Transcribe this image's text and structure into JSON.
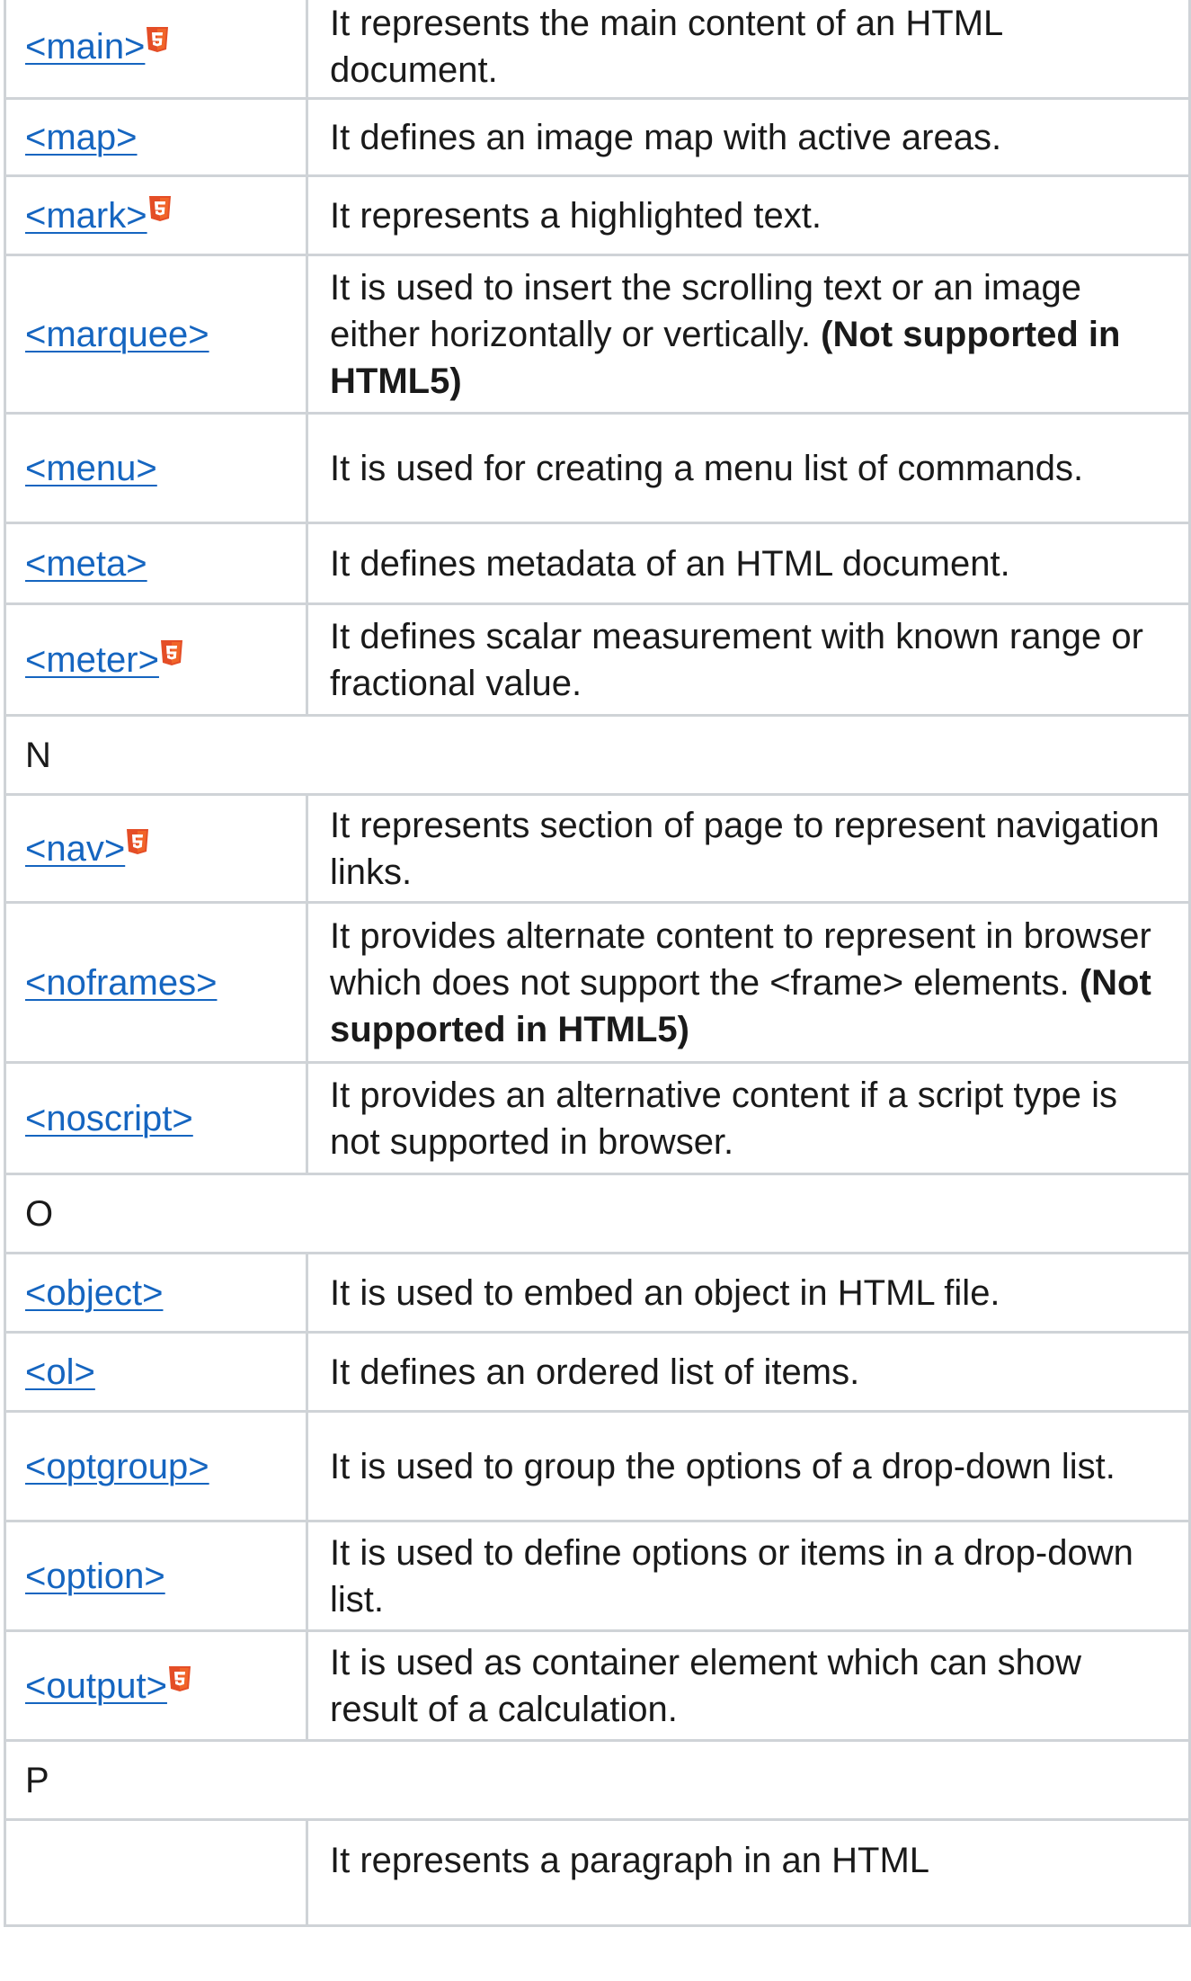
{
  "colors": {
    "link": "#1565c0",
    "border": "#cfd3d7",
    "html5_badge": "#e44d26"
  },
  "rows": [
    {
      "kind": "tag",
      "tag": "<main>",
      "html5": true,
      "desc": "It represents the main content of an HTML document.",
      "note": ""
    },
    {
      "kind": "tag",
      "tag": "<map>",
      "html5": false,
      "desc": "It defines an image map with active areas.",
      "note": ""
    },
    {
      "kind": "tag",
      "tag": "<mark>",
      "html5": true,
      "desc": "It represents a highlighted text.",
      "note": ""
    },
    {
      "kind": "tag",
      "tag": "<marquee>",
      "html5": false,
      "desc": "It is used to insert the scrolling text or an image either horizontally or vertically.",
      "note": "(Not supported in HTML5)"
    },
    {
      "kind": "tag",
      "tag": "<menu>",
      "html5": false,
      "desc": "It is used for creating a menu list of commands.",
      "note": ""
    },
    {
      "kind": "tag",
      "tag": "<meta>",
      "html5": false,
      "desc": "It defines metadata of an HTML document.",
      "note": ""
    },
    {
      "kind": "tag",
      "tag": "<meter>",
      "html5": true,
      "desc": "It defines scalar measurement with known range or fractional value.",
      "note": ""
    },
    {
      "kind": "letter",
      "letter": "N"
    },
    {
      "kind": "tag",
      "tag": "<nav>",
      "html5": true,
      "desc": "It represents section of page to represent navigation links.",
      "note": ""
    },
    {
      "kind": "tag",
      "tag": "<noframes>",
      "html5": false,
      "desc": "It provides alternate content to represent in browser which does not support the <frame> elements.",
      "note": "(Not supported in HTML5)"
    },
    {
      "kind": "tag",
      "tag": "<noscript>",
      "html5": false,
      "desc": "It provides an alternative content if a script type is not supported in browser.",
      "note": ""
    },
    {
      "kind": "letter",
      "letter": "O"
    },
    {
      "kind": "tag",
      "tag": "<object>",
      "html5": false,
      "desc": "It is used to embed an object in HTML file.",
      "note": ""
    },
    {
      "kind": "tag",
      "tag": "<ol>",
      "html5": false,
      "desc": "It defines an ordered list of items.",
      "note": ""
    },
    {
      "kind": "tag",
      "tag": "<optgroup>",
      "html5": false,
      "desc": "It is used to group the options of a drop-down list.",
      "note": ""
    },
    {
      "kind": "tag",
      "tag": "<option>",
      "html5": false,
      "desc": "It is used to define options or items in a drop-down list.",
      "note": ""
    },
    {
      "kind": "tag",
      "tag": "<output>",
      "html5": true,
      "desc": "It is used as container element which can show result of a calculation.",
      "note": ""
    },
    {
      "kind": "letter",
      "letter": "P"
    },
    {
      "kind": "tag",
      "tag": "",
      "html5": false,
      "desc": "It represents a paragraph in an HTML",
      "note": ""
    }
  ]
}
